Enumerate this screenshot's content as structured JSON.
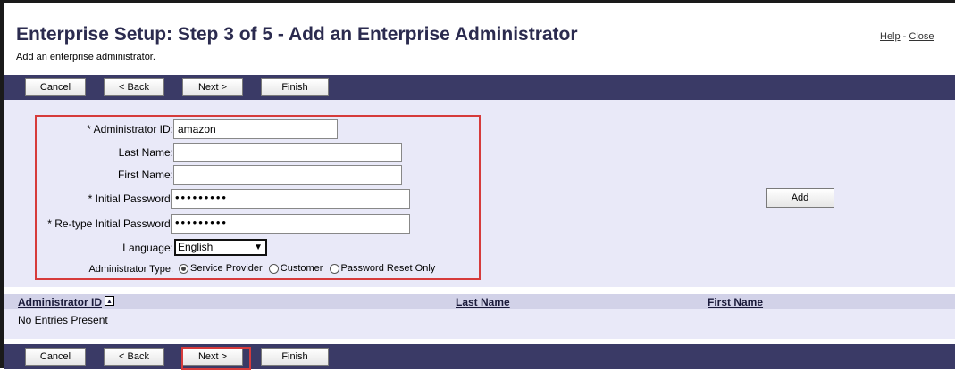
{
  "header": {
    "title": "Enterprise Setup: Step 3 of 5 - Add an Enterprise Administrator",
    "subtitle": "Add an enterprise administrator.",
    "help_link": "Help",
    "separator": " - ",
    "close_link": "Close"
  },
  "toolbar": {
    "cancel_label": "Cancel",
    "back_label": "< Back",
    "next_label": "Next >",
    "finish_label": "Finish"
  },
  "form": {
    "admin_id_label": "* Administrator ID:",
    "admin_id_value": "amazon",
    "last_name_label": "Last Name:",
    "last_name_value": "",
    "first_name_label": "First Name:",
    "first_name_value": "",
    "initial_password_label": "* Initial Password:",
    "initial_password_value": "•••••••••",
    "retype_password_label": "* Re-type Initial Password:",
    "retype_password_value": "•••••••••",
    "language_label": "Language:",
    "language_value": "English",
    "admin_type_label": "Administrator Type:",
    "admin_type_options": [
      "Service Provider",
      "Customer",
      "Password Reset Only"
    ],
    "admin_type_selected": "Service Provider",
    "add_button_label": "Add"
  },
  "table": {
    "columns": [
      "Administrator ID",
      "Last Name",
      "First Name"
    ],
    "sort_indicator": "▲",
    "empty_message": "No Entries Present"
  },
  "colors": {
    "toolbar_bg": "#3a3a66",
    "panel_bg": "#e9e9f8",
    "highlight": "#d63b3b",
    "title": "#2b2b4f"
  }
}
